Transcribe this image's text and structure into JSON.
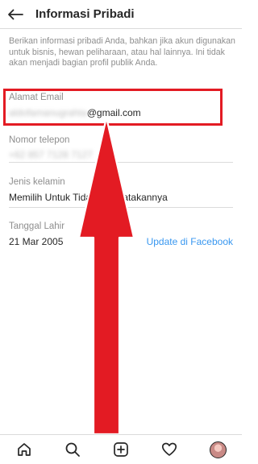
{
  "header": {
    "title": "Informasi Pribadi",
    "back_icon": "arrow-left-icon"
  },
  "intro_text": "Berikan informasi pribadi Anda, bahkan jika akun digunakan untuk bisnis, hewan peliharaan, atau hal lainnya. Ini tidak akan menjadi bagian profil publik Anda.",
  "fields": {
    "email": {
      "label": "Alamat Email",
      "value_hidden": "aldofamanugrahta",
      "value_visible": "@gmail.com"
    },
    "phone": {
      "label": "Nomor telepon",
      "value": "+62 857 7128 7127"
    },
    "gender": {
      "label": "Jenis kelamin",
      "value": "Memilih Untuk Tidak Mengatakannya"
    },
    "birthday": {
      "label": "Tanggal Lahir",
      "value": "21 Mar 2005",
      "link": "Update di Facebook"
    }
  },
  "annotation": {
    "highlight_color": "#e31b23",
    "arrow_color": "#e31b23"
  },
  "colors": {
    "accent_link": "#3897f0",
    "muted_text": "#8e8e8e",
    "primary_text": "#262626",
    "divider": "#dbdbdb"
  },
  "bottom_nav": {
    "items": [
      "home-icon",
      "search-icon",
      "add-post-icon",
      "activity-heart-icon",
      "profile-avatar"
    ]
  }
}
